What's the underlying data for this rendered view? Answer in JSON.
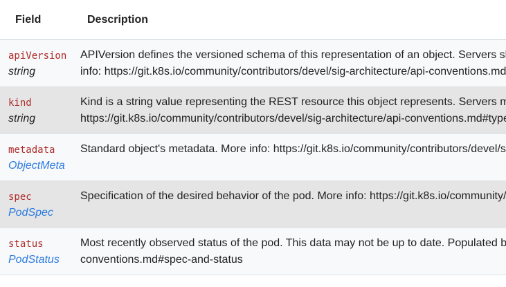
{
  "header": {
    "field_label": "Field",
    "description_label": "Description"
  },
  "rows": [
    {
      "name": "apiVersion",
      "type": "string",
      "type_is_link": false,
      "lines": [
        "APIVersion defines the versioned schema of this representation of an object. Servers sh",
        "info: https://git.k8s.io/community/contributors/devel/sig-architecture/api-conventions.md"
      ]
    },
    {
      "name": "kind",
      "type": "string",
      "type_is_link": false,
      "lines": [
        "Kind is a string value representing the REST resource this object represents. Servers m",
        "https://git.k8s.io/community/contributors/devel/sig-architecture/api-conventions.md#type"
      ]
    },
    {
      "name": "metadata",
      "type": "ObjectMeta",
      "type_is_link": true,
      "lines": [
        "Standard object's metadata. More info: https://git.k8s.io/community/contributors/devel/s"
      ]
    },
    {
      "name": "spec",
      "type": "PodSpec",
      "type_is_link": true,
      "lines": [
        "Specification of the desired behavior of the pod. More info: https://git.k8s.io/community/"
      ]
    },
    {
      "name": "status",
      "type": "PodStatus",
      "type_is_link": true,
      "lines": [
        "Most recently observed status of the pod. This data may not be up to date. Populated b",
        "conventions.md#spec-and-status"
      ]
    }
  ],
  "colors": {
    "field_name": "#b02a2a",
    "link": "#2a7ae2",
    "row_shaded": "#e5e5e5",
    "row_plain": "#f8f9fa"
  }
}
